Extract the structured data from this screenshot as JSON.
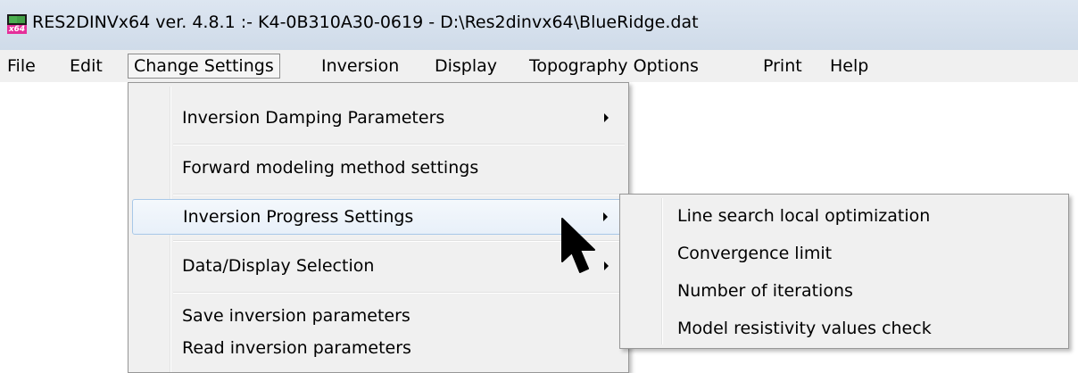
{
  "window": {
    "title": "RES2DINVx64 ver. 4.8.1 :- K4-0B310A30-0619 - D:\\Res2dinvx64\\BlueRidge.dat",
    "icon": "res2dinv-app-icon",
    "icon_text": "x64"
  },
  "menubar": {
    "items": [
      "File",
      "Edit",
      "Change Settings",
      "Inversion",
      "Display",
      "Topography Options",
      "Print",
      "Help"
    ],
    "open_item": "Change Settings"
  },
  "dropdown": {
    "items": [
      {
        "label": "Inversion Damping Parameters",
        "has_submenu": true
      },
      {
        "label": "Forward modeling method settings",
        "has_submenu": false
      },
      {
        "label": "Inversion Progress Settings",
        "has_submenu": true,
        "highlighted": true
      },
      {
        "label": "Data/Display Selection",
        "has_submenu": true
      },
      {
        "label": "Save inversion parameters",
        "has_submenu": false
      },
      {
        "label": "Read inversion parameters",
        "has_submenu": false
      }
    ]
  },
  "submenu": {
    "parent": "Inversion Progress Settings",
    "items": [
      "Line search local optimization",
      "Convergence limit",
      "Number of iterations",
      "Model resistivity values check"
    ]
  },
  "cursor": {
    "icon": "arrow-cursor-icon"
  },
  "colors": {
    "titlebar": "#d6e1ee",
    "menu_bg": "#f0f0f0",
    "highlight_border": "#a8c8e8",
    "icon_green": "#4caf50",
    "icon_pink": "#e52f9a"
  }
}
